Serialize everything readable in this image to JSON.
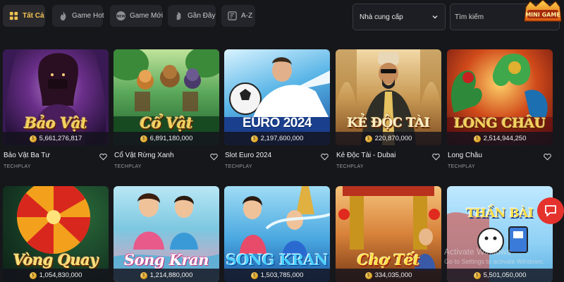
{
  "tabs": [
    {
      "label": "Tất Cả",
      "icon": "grid-icon",
      "active": true
    },
    {
      "label": "Game Hot",
      "icon": "flame-icon",
      "active": false
    },
    {
      "label": "Game Mới",
      "icon": "new-badge-icon",
      "active": false
    },
    {
      "label": "Gần Đây",
      "icon": "recent-hand-icon",
      "active": false
    },
    {
      "label": "A-Z",
      "icon": "az-sort-icon",
      "active": false
    }
  ],
  "filters": {
    "provider_select": "Nhà cung cấp",
    "search_placeholder": "Tìm kiếm"
  },
  "logo": {
    "text": "MINI GAME"
  },
  "games": [
    {
      "name": "Bảo Vật Ba Tư",
      "provider": "TECHPLAY",
      "jackpot": "5,661,276,817",
      "art_title": "Bảo Vật"
    },
    {
      "name": "Cổ Vật Rừng Xanh",
      "provider": "TECHPLAY",
      "jackpot": "6,891,180,000",
      "art_title": "Cổ Vật"
    },
    {
      "name": "Slot Euro 2024",
      "provider": "TECHPLAY",
      "jackpot": "2,197,600,000",
      "art_title": "EURO 2024"
    },
    {
      "name": "Kẻ Độc Tài - Dubai",
      "provider": "TECHPLAY",
      "jackpot": "220,870,000",
      "art_title": "KẺ ĐỘC TÀI"
    },
    {
      "name": "Long Châu",
      "provider": "TECHPLAY",
      "jackpot": "2,514,944,250",
      "art_title": "LONG CHÂU"
    },
    {
      "name": "",
      "provider": "",
      "jackpot": "1,054,830,000",
      "art_title": "Vòng Quay"
    },
    {
      "name": "",
      "provider": "",
      "jackpot": "1,214,880,000",
      "art_title": "Song Kran"
    },
    {
      "name": "",
      "provider": "",
      "jackpot": "1,503,785,000",
      "art_title": "SONG KRAN"
    },
    {
      "name": "",
      "provider": "",
      "jackpot": "334,035,000",
      "art_title": "Chợ Tết"
    },
    {
      "name": "",
      "provider": "",
      "jackpot": "5,501,050,000",
      "art_title": "THẦN BÀI"
    }
  ],
  "watermark": {
    "title": "Activate Windows",
    "subtitle": "Go to Settings to activate Windows."
  },
  "colors": {
    "accent": "#f3c34f",
    "chat": "#e5322d",
    "background": "#16171b"
  }
}
